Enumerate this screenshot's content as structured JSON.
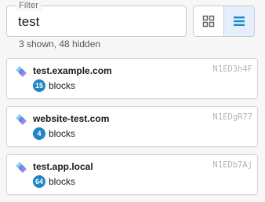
{
  "filter": {
    "label": "Filter",
    "value": "test"
  },
  "summary": "3 shown, 48 hidden",
  "view_toggle": {
    "options": [
      "grid-view-icon",
      "list-view-icon"
    ],
    "selected": "list"
  },
  "colors": {
    "accent": "#1f86c6",
    "toggle_active": "#e4eefc",
    "logo_light": "#8ec5f2",
    "logo_mid": "#4a90e2",
    "logo_purple": "#a56be0"
  },
  "items": [
    {
      "name": "test.example.com",
      "id": "N1ED3h4F",
      "count": "15",
      "unit": "blocks",
      "icon": "brand-logo-icon"
    },
    {
      "name": "website-test.com",
      "id": "N1EDgR77",
      "count": "4",
      "unit": "blocks",
      "icon": "brand-logo-icon"
    },
    {
      "name": "test.app.local",
      "id": "N1EDb7Aj",
      "count": "64",
      "unit": "blocks",
      "icon": "brand-logo-icon"
    }
  ]
}
